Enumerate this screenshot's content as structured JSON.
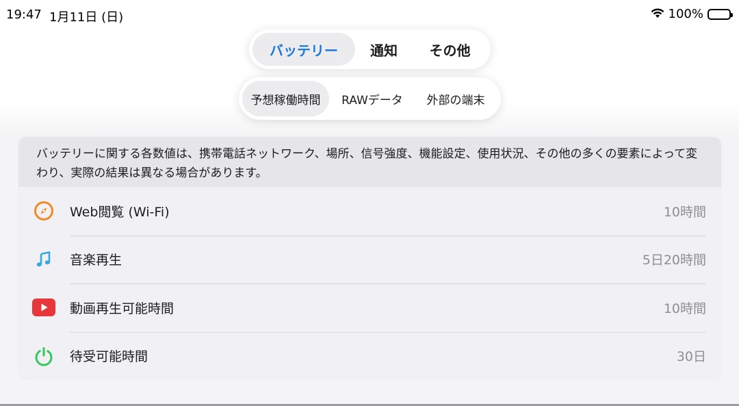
{
  "status_bar": {
    "time": "19:47",
    "date": "1月11日 (日)",
    "battery_percent": "100%",
    "icons": [
      "wifi-icon",
      "battery-icon"
    ]
  },
  "primary_tabs": {
    "selected": 0,
    "items": [
      {
        "label": "バッテリー"
      },
      {
        "label": "通知"
      },
      {
        "label": "その他"
      }
    ]
  },
  "secondary_tabs": {
    "selected": 0,
    "items": [
      {
        "label": "予想稼働時間"
      },
      {
        "label": "RAWデータ"
      },
      {
        "label": "外部の端末"
      }
    ]
  },
  "battery": {
    "note": "バッテリーに関する各数値は、携帯電話ネットワーク、場所、信号強度、機能設定、使用状況、その他の多くの要素によって変わり、実際の結果は異なる場合があります。",
    "rows": [
      {
        "icon": "compass-icon",
        "label": "Web閲覧 (Wi-Fi)",
        "value": "10時間"
      },
      {
        "icon": "music-note-icon",
        "label": "音楽再生",
        "value": "5日20時間"
      },
      {
        "icon": "video-play-icon",
        "label": "動画再生可能時間",
        "value": "10時間"
      },
      {
        "icon": "power-icon",
        "label": "待受可能時間",
        "value": "30日"
      }
    ]
  },
  "colors": {
    "accent": "#1a79d6",
    "compass": "#f08a24",
    "music": "#34aadc",
    "video": "#e8373a",
    "power": "#34c759"
  }
}
